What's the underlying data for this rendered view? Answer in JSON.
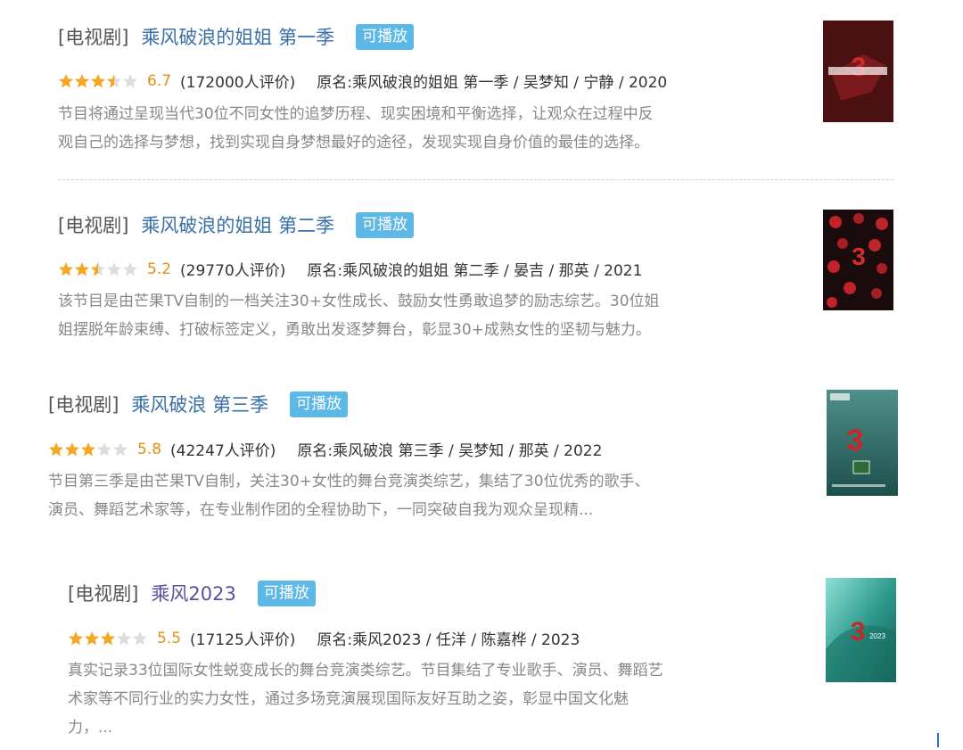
{
  "results": [
    {
      "category": "[电视剧]",
      "title": "乘风破浪的姐姐 第一季",
      "badge": "可播放",
      "rating": 3.5,
      "score": "6.7",
      "votes": "(172000人评价)",
      "meta": "原名:乘风破浪的姐姐 第一季 / 吴梦知 / 宁静 / 2020",
      "desc_lines": [
        "节目将通过呈现当代30位不同女性的追梦历程、现实困境和平衡选择，让观众在过程中反",
        "观自己的选择与梦想，找到实现自身梦想最好的途径，发现实现自身价值的最佳的选择。"
      ]
    },
    {
      "category": "[电视剧]",
      "title": "乘风破浪的姐姐 第二季",
      "badge": "可播放",
      "rating": 2.5,
      "score": "5.2",
      "votes": "(29770人评价)",
      "meta": "原名:乘风破浪的姐姐 第二季 / 晏吉 / 那英 / 2021",
      "desc_lines": [
        "该节目是由芒果TV自制的一档关注30+女性成长、鼓励女性勇敢追梦的励志综艺。30位姐",
        "姐摆脱年龄束缚、打破标签定义，勇敢出发逐梦舞台，彰显30+成熟女性的坚韧与魅力。"
      ]
    },
    {
      "category": "[电视剧]",
      "title": "乘风破浪 第三季",
      "badge": "可播放",
      "rating": 3,
      "score": "5.8",
      "votes": "(42247人评价)",
      "meta": "原名:乘风破浪 第三季 / 吴梦知 / 那英 / 2022",
      "desc_lines": [
        "节目第三季是由芒果TV自制，关注30+女性的舞台竞演类综艺，集结了30位优秀的歌手、",
        "演员、舞蹈艺术家等，在专业制作团的全程协助下，一同突破自我为观众呈现精..."
      ]
    },
    {
      "category": "[电视剧]",
      "title": "乘风2023",
      "badge": "可播放",
      "rating": 3,
      "score": "5.5",
      "votes": "(17125人评价)",
      "meta": "原名:乘风2023 / 任洋 / 陈嘉桦 / 2023",
      "desc_lines": [
        "真实记录33位国际女性蜕变成长的舞台竞演类综艺。节目集结了专业歌手、演员、舞蹈艺",
        "术家等不同行业的实力女性，通过多场竞演展现国际友好互助之姿，彰显中国文化魅",
        "力，..."
      ]
    }
  ],
  "colors": {
    "title_link": "#3a6fa8",
    "score": "#e09015",
    "star_on": "#f5a623",
    "star_off": "#dddddd",
    "badge_bg": "#5cb8e6",
    "desc": "#888888"
  }
}
